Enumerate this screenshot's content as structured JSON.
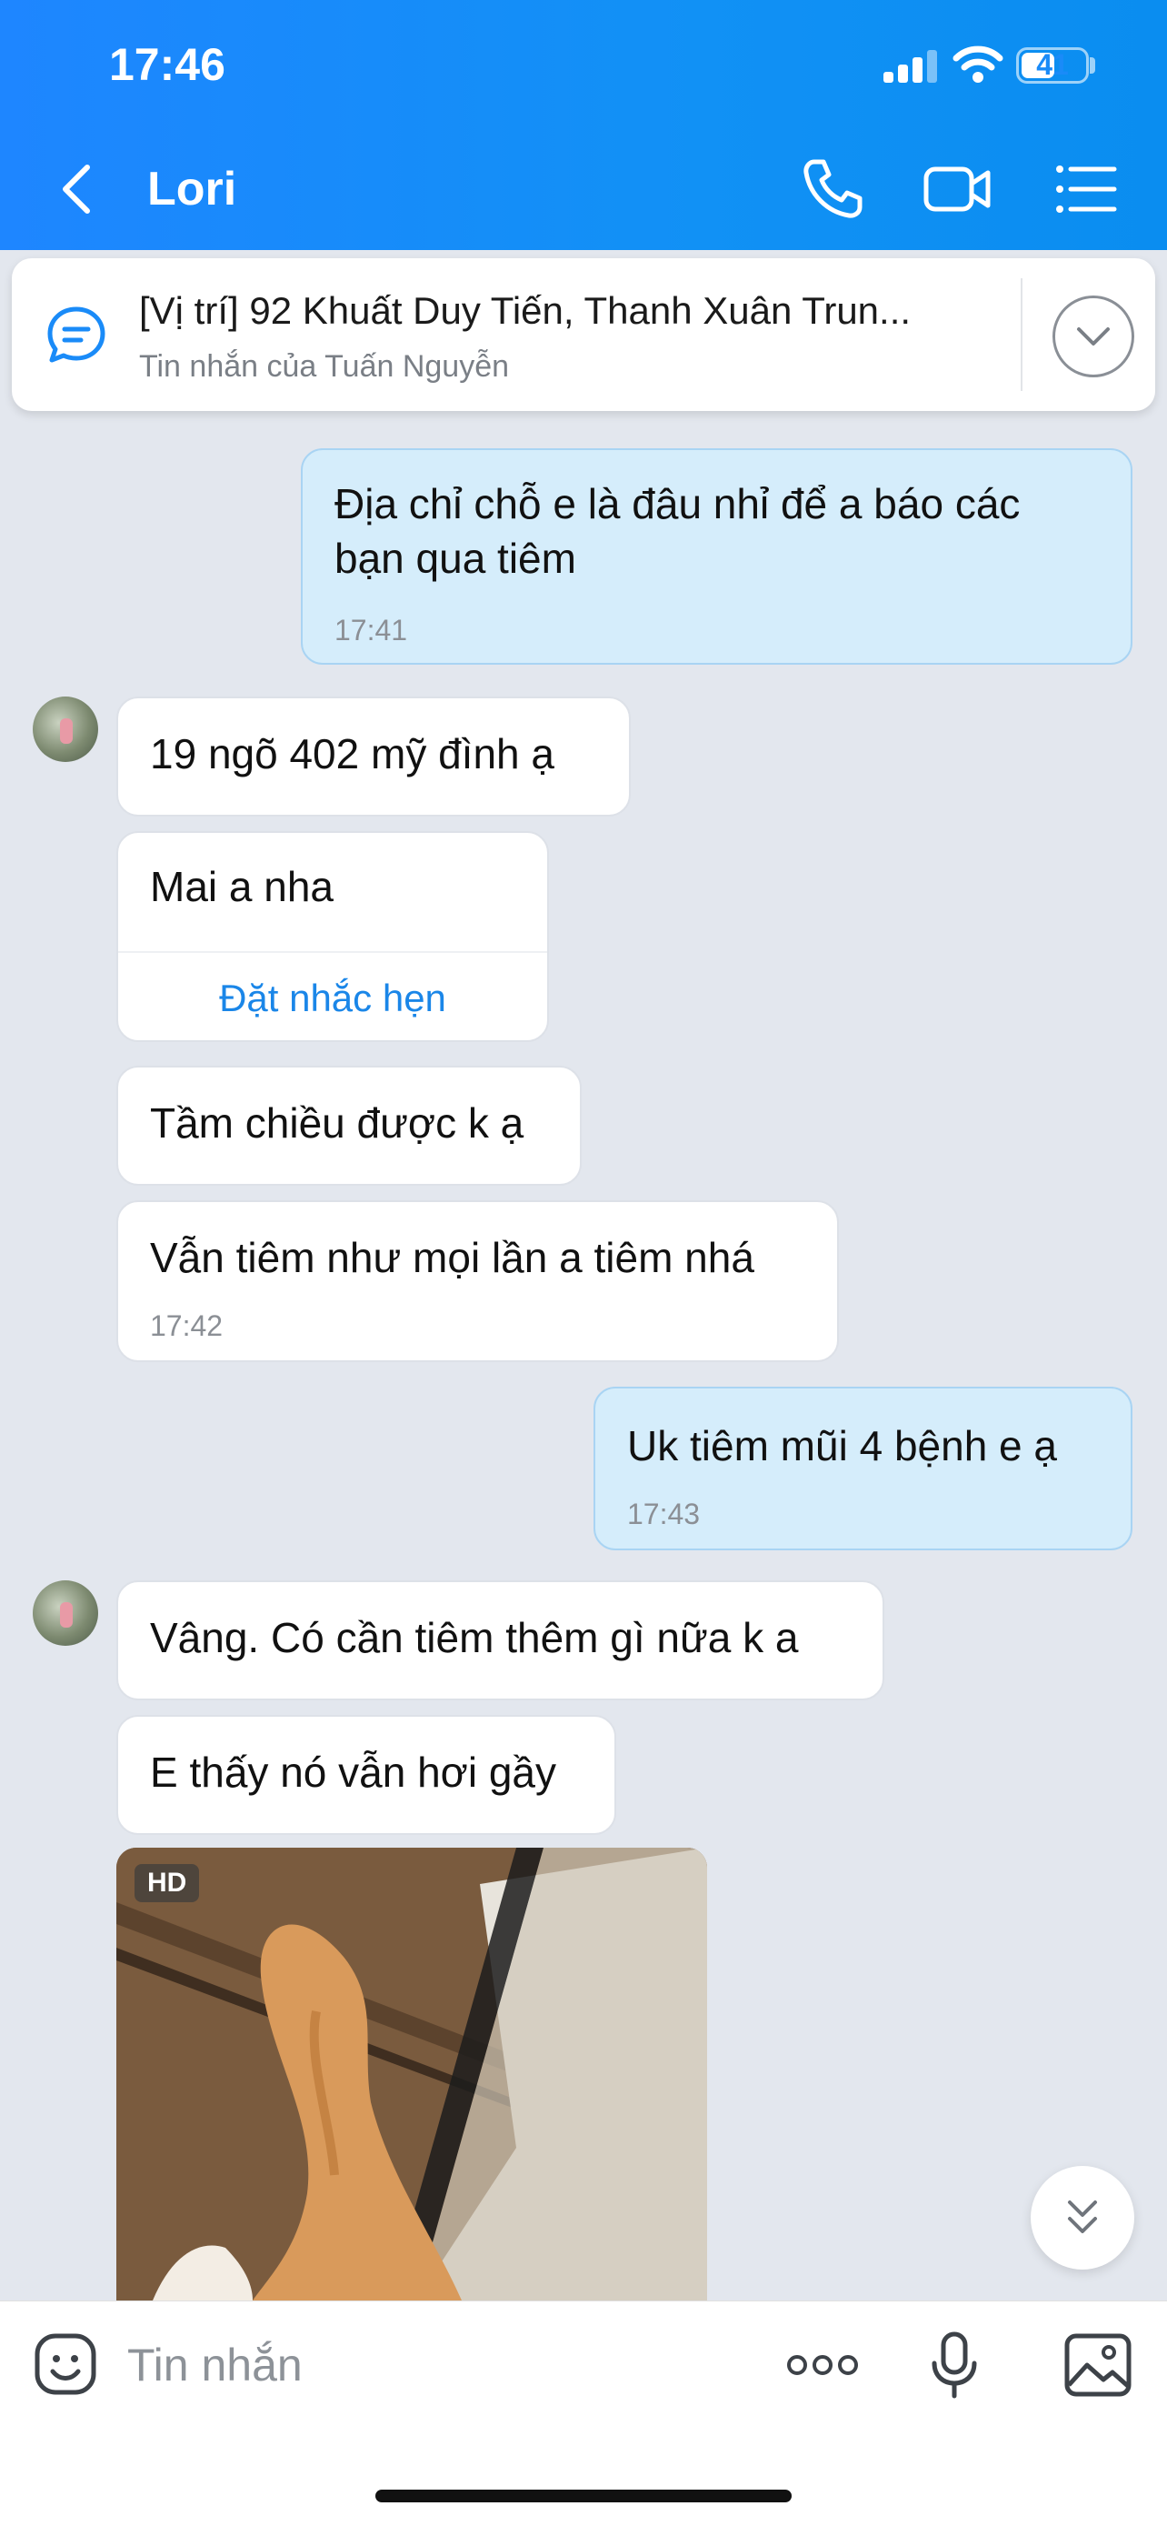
{
  "status_bar": {
    "time": "17:46",
    "battery": "41"
  },
  "header": {
    "contact_name": "Lori"
  },
  "pinned": {
    "title": "[Vị trí] 92 Khuất Duy Tiến, Thanh Xuân Trun...",
    "subtitle": "Tin nhắn của Tuấn Nguyễn"
  },
  "messages": [
    {
      "direction": "out",
      "lines": [
        "Địa chỉ chỗ e là đâu nhỉ để a báo các",
        "bạn qua tiêm"
      ],
      "time": "17:41"
    },
    {
      "direction": "in",
      "text": "19 ngõ 402 mỹ đình ạ"
    },
    {
      "direction": "in",
      "text": "Mai a nha",
      "action": "Đặt nhắc hẹn"
    },
    {
      "direction": "in",
      "text": "Tầm chiều được k ạ"
    },
    {
      "direction": "in",
      "text": "Vẫn tiêm như mọi lần a tiêm nhá",
      "time": "17:42"
    },
    {
      "direction": "out",
      "text": "Uk tiêm mũi 4 bệnh e ạ",
      "time": "17:43"
    },
    {
      "direction": "in",
      "text": "Vâng. Có cần tiêm thêm gì nữa k a"
    },
    {
      "direction": "in",
      "text": "E thấy nó vẫn hơi gầy"
    },
    {
      "direction": "in",
      "type": "image",
      "badge": "HD"
    }
  ],
  "input": {
    "placeholder": "Tin nhắn"
  },
  "colors": {
    "header_blue": "#1a8bf8",
    "outgoing_bubble": "#d5edfb",
    "link_blue": "#1a86e8",
    "background": "#e3e7ee"
  }
}
